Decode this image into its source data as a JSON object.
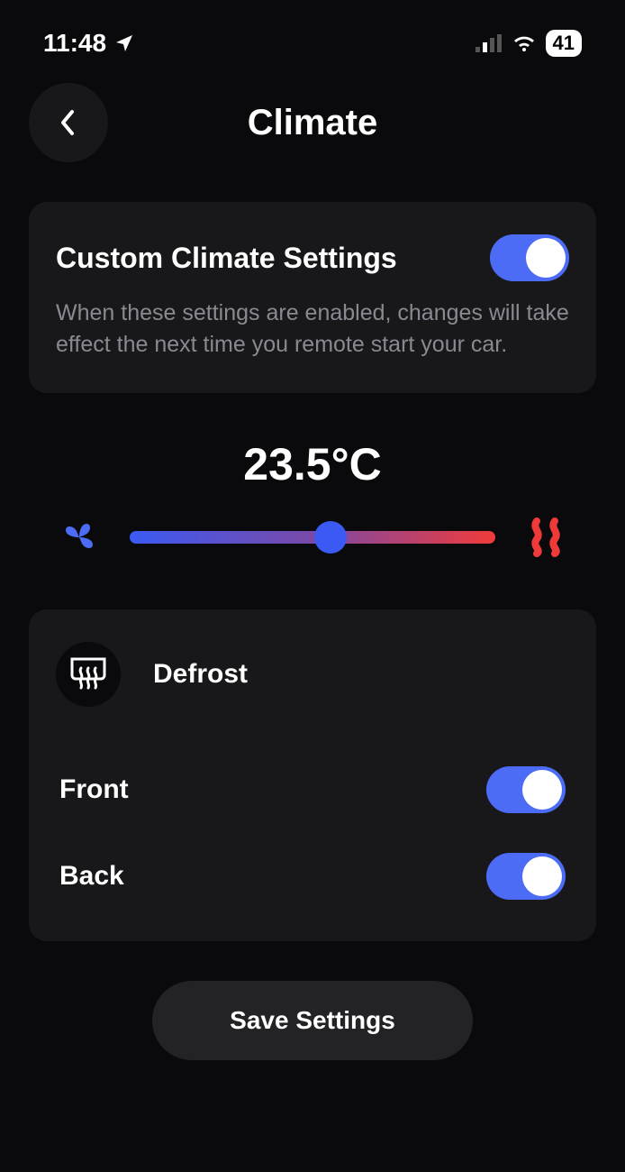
{
  "status": {
    "time": "11:48",
    "battery": "41"
  },
  "header": {
    "title": "Climate"
  },
  "custom_settings": {
    "title": "Custom Climate Settings",
    "description": "When these settings are enabled, changes will take effect the next time you remote start your car.",
    "enabled": true
  },
  "temperature": {
    "value": "23.5°C",
    "slider_position_percent": 55
  },
  "defrost": {
    "title": "Defrost",
    "front": {
      "label": "Front",
      "enabled": true
    },
    "back": {
      "label": "Back",
      "enabled": true
    }
  },
  "actions": {
    "save_label": "Save Settings"
  },
  "colors": {
    "accent": "#4d6cf5",
    "cool": "#3b5af3",
    "warm": "#f03a3a",
    "card_bg": "#18181b"
  }
}
